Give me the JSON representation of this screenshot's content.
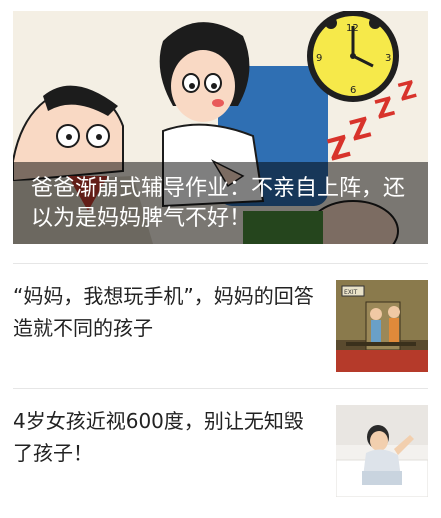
{
  "hero": {
    "title": "爸爸渐崩式辅导作业：不亲自上阵，还以为是妈妈脾气不好！",
    "image_icon": "cartoon-parents-homework-illustration"
  },
  "articles": [
    {
      "title": "“妈妈，我想玩手机”，妈妈的回答造就不同的孩子",
      "thumb_icon": "children-in-room-illustration",
      "thumb_sign": "EXIT"
    },
    {
      "title": "4岁女孩近视600度，别让无知毁了孩子！",
      "thumb_icon": "child-in-bed-photo"
    }
  ]
}
